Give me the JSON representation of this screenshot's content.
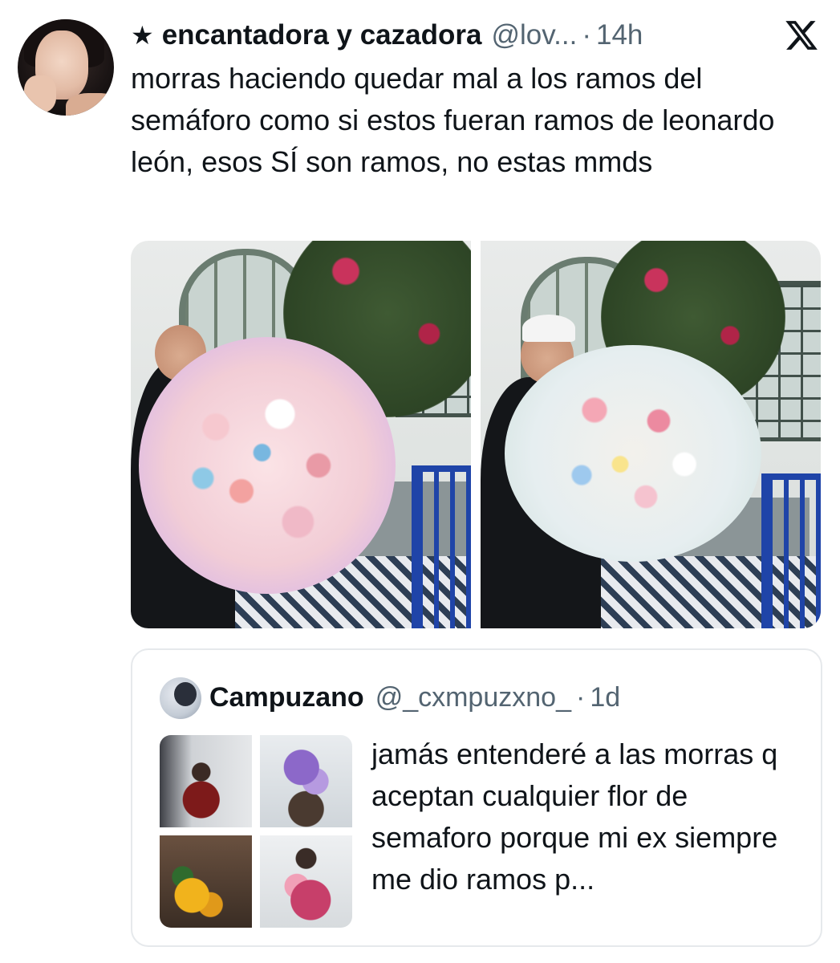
{
  "tweet": {
    "star": "★",
    "display_name": "encantadora y cazadora",
    "handle": "@lov...",
    "separator": "·",
    "time": "14h",
    "text": "morras haciendo quedar mal a los ramos del semáforo como si estos fueran ramos de leonardo león, esos SÍ son ramos, no estas mmds",
    "media_count": 2
  },
  "brand": {
    "logo_icon": "x-logo-icon"
  },
  "quote": {
    "display_name": "Campuzano",
    "handle": "@_cxmpuzxno_",
    "separator": "·",
    "time": "1d",
    "text": "jamás entenderé a las morras q aceptan cualquier flor de semaforo porque mi ex siempre me dio ramos p...",
    "thumbnail_count": 4
  },
  "colors": {
    "text": "#0f1419",
    "secondary_text": "#536471",
    "border": "#e6e9ec",
    "background": "#ffffff"
  }
}
